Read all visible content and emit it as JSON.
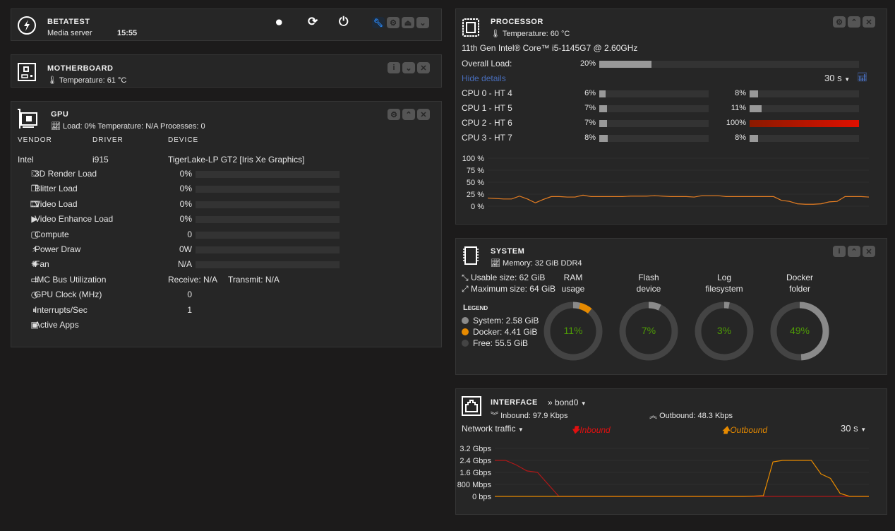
{
  "server": {
    "title": "BETATEST",
    "description": "Media server",
    "time": "15:55",
    "buttons": [
      "stop",
      "refresh",
      "power"
    ]
  },
  "motherboard": {
    "title": "MOTHERBOARD",
    "temperature": "Temperature: 61 °C"
  },
  "gpu": {
    "title": "GPU",
    "summary": "Load: 0% Temperature: N/A Processes: 0",
    "headers": [
      "VENDOR",
      "DRIVER",
      "DEVICE"
    ],
    "vendor": "Intel",
    "driver": "i915",
    "device": "TigerLake-LP GT2 [Iris Xe Graphics]",
    "rows": [
      {
        "icon": "cubes-icon",
        "label": "3D Render Load",
        "value": "0%",
        "bar": 0
      },
      {
        "icon": "clone-icon",
        "label": "Blitter Load",
        "value": "0%",
        "bar": 0
      },
      {
        "icon": "film-icon",
        "label": "Video Load",
        "value": "0%",
        "bar": 0
      },
      {
        "icon": "video-icon",
        "label": "Video Enhance Load",
        "value": "0%",
        "bar": 0
      },
      {
        "icon": "square-icon",
        "label": "Compute",
        "value": "0",
        "bar": 0
      },
      {
        "icon": "plug-icon",
        "label": "Power Draw",
        "value": "0W",
        "bar": 0
      },
      {
        "icon": "fan-icon",
        "label": "Fan",
        "value": "N/A",
        "bar": 0
      },
      {
        "icon": "bus-icon",
        "label": "IMC Bus Utilization",
        "receive": "Receive: N/A",
        "transmit": "Transmit: N/A"
      },
      {
        "icon": "clock-icon",
        "label": "GPU Clock (MHz)",
        "value": "0"
      },
      {
        "icon": "pause-icon",
        "label": "Interrupts/Sec",
        "value": "1"
      },
      {
        "icon": "apps-icon",
        "label": "Active Apps"
      }
    ]
  },
  "processor": {
    "title": "PROCESSOR",
    "temperature": "Temperature: 60 °C",
    "model": "11th Gen Intel® Core™ i5-1145G7 @ 2.60GHz",
    "overall_label": "Overall Load:",
    "overall": "20%",
    "overall_value": 20,
    "hide_details": "Hide details",
    "interval": "30 s",
    "cores": [
      {
        "label": "CPU 0 - HT 4",
        "a": "6%",
        "av": 6,
        "b": "8%",
        "bv": 8
      },
      {
        "label": "CPU 1 - HT 5",
        "a": "7%",
        "av": 7,
        "b": "11%",
        "bv": 11
      },
      {
        "label": "CPU 2 - HT 6",
        "a": "7%",
        "av": 7,
        "b": "100%",
        "bv": 100
      },
      {
        "label": "CPU 3 - HT 7",
        "a": "8%",
        "av": 8,
        "b": "8%",
        "bv": 8
      }
    ],
    "high_color": "#e01000"
  },
  "system": {
    "title": "SYSTEM",
    "memory": "Memory: 32 GiB DDR4",
    "usable": "Usable size: 62 GiB",
    "maximum": "Maximum size: 64 GiB",
    "legend_title": "Legend",
    "legend": [
      {
        "label": "System: 2.58 GiB",
        "color": "#8a8a8a"
      },
      {
        "label": "Docker: 4.41 GiB",
        "color": "#e68a00"
      },
      {
        "label": "Free: 55.5 GiB",
        "color": "#444444"
      }
    ],
    "donuts": [
      {
        "l1": "RAM",
        "l2": "usage",
        "pct": "11%",
        "segments": [
          {
            "v": 4,
            "color": "#8a8a8a"
          },
          {
            "v": 7,
            "color": "#e68a00"
          }
        ]
      },
      {
        "l1": "Flash",
        "l2": "device",
        "pct": "7%",
        "segments": [
          {
            "v": 7,
            "color": "#8a8a8a"
          }
        ]
      },
      {
        "l1": "Log",
        "l2": "filesystem",
        "pct": "3%",
        "segments": [
          {
            "v": 3,
            "color": "#8a8a8a"
          }
        ]
      },
      {
        "l1": "Docker",
        "l2": "folder",
        "pct": "49%",
        "segments": [
          {
            "v": 49,
            "color": "#8a8a8a"
          }
        ]
      }
    ]
  },
  "interface": {
    "title": "INTERFACE",
    "name": "bond0",
    "inbound": "Inbound: 97.9 Kbps",
    "outbound": "Outbound: 48.3 Kbps",
    "mode": "Network traffic",
    "legend_in": "Inbound",
    "legend_out": "Outbound",
    "interval": "30 s",
    "in_color": "#e01010",
    "out_color": "#e68a00"
  },
  "chart_data": [
    {
      "type": "line",
      "ylabels": [
        "100 %",
        "75 %",
        "50 %",
        "25 %",
        "0 %"
      ],
      "ylim": [
        0,
        100
      ],
      "series": [
        {
          "color": "#e67e22",
          "values": [
            17,
            16,
            15,
            15,
            21,
            15,
            7,
            14,
            20,
            20,
            19,
            19,
            23,
            20,
            20,
            20,
            20,
            20,
            21,
            21,
            21,
            22,
            21,
            20,
            20,
            20,
            19,
            22,
            22,
            22,
            20,
            20,
            20,
            20,
            20,
            20,
            20,
            12,
            10,
            5,
            4,
            4,
            5,
            9,
            10,
            20,
            20,
            20,
            19
          ]
        }
      ]
    },
    {
      "type": "line",
      "ylabels": [
        "3.2 Gbps",
        "2.4 Gbps",
        "1.6 Gbps",
        "800 Mbps",
        "0 bps"
      ],
      "ylim": [
        0,
        3.2
      ],
      "series": [
        {
          "name": "Inbound",
          "color": "#b01818",
          "values": [
            2.4,
            2.4,
            2.1,
            1.7,
            1.6,
            0.8,
            0,
            0,
            0,
            0,
            0,
            0,
            0,
            0,
            0,
            0,
            0,
            0,
            0,
            0,
            0,
            0,
            0,
            0,
            0,
            0,
            0,
            0,
            0,
            0,
            0,
            0,
            0,
            0,
            0,
            0
          ]
        },
        {
          "name": "Outbound",
          "color": "#e68a00",
          "values": [
            0,
            0,
            0,
            0,
            0,
            0,
            0,
            0,
            0,
            0,
            0,
            0,
            0,
            0,
            0,
            0,
            0,
            0,
            0,
            0,
            0,
            0,
            0,
            0,
            0,
            0,
            0,
            0.02,
            0.05,
            2.3,
            2.4,
            2.4,
            2.4,
            2.4,
            1.5,
            1.2,
            0.2,
            0,
            0,
            0
          ]
        }
      ]
    }
  ]
}
